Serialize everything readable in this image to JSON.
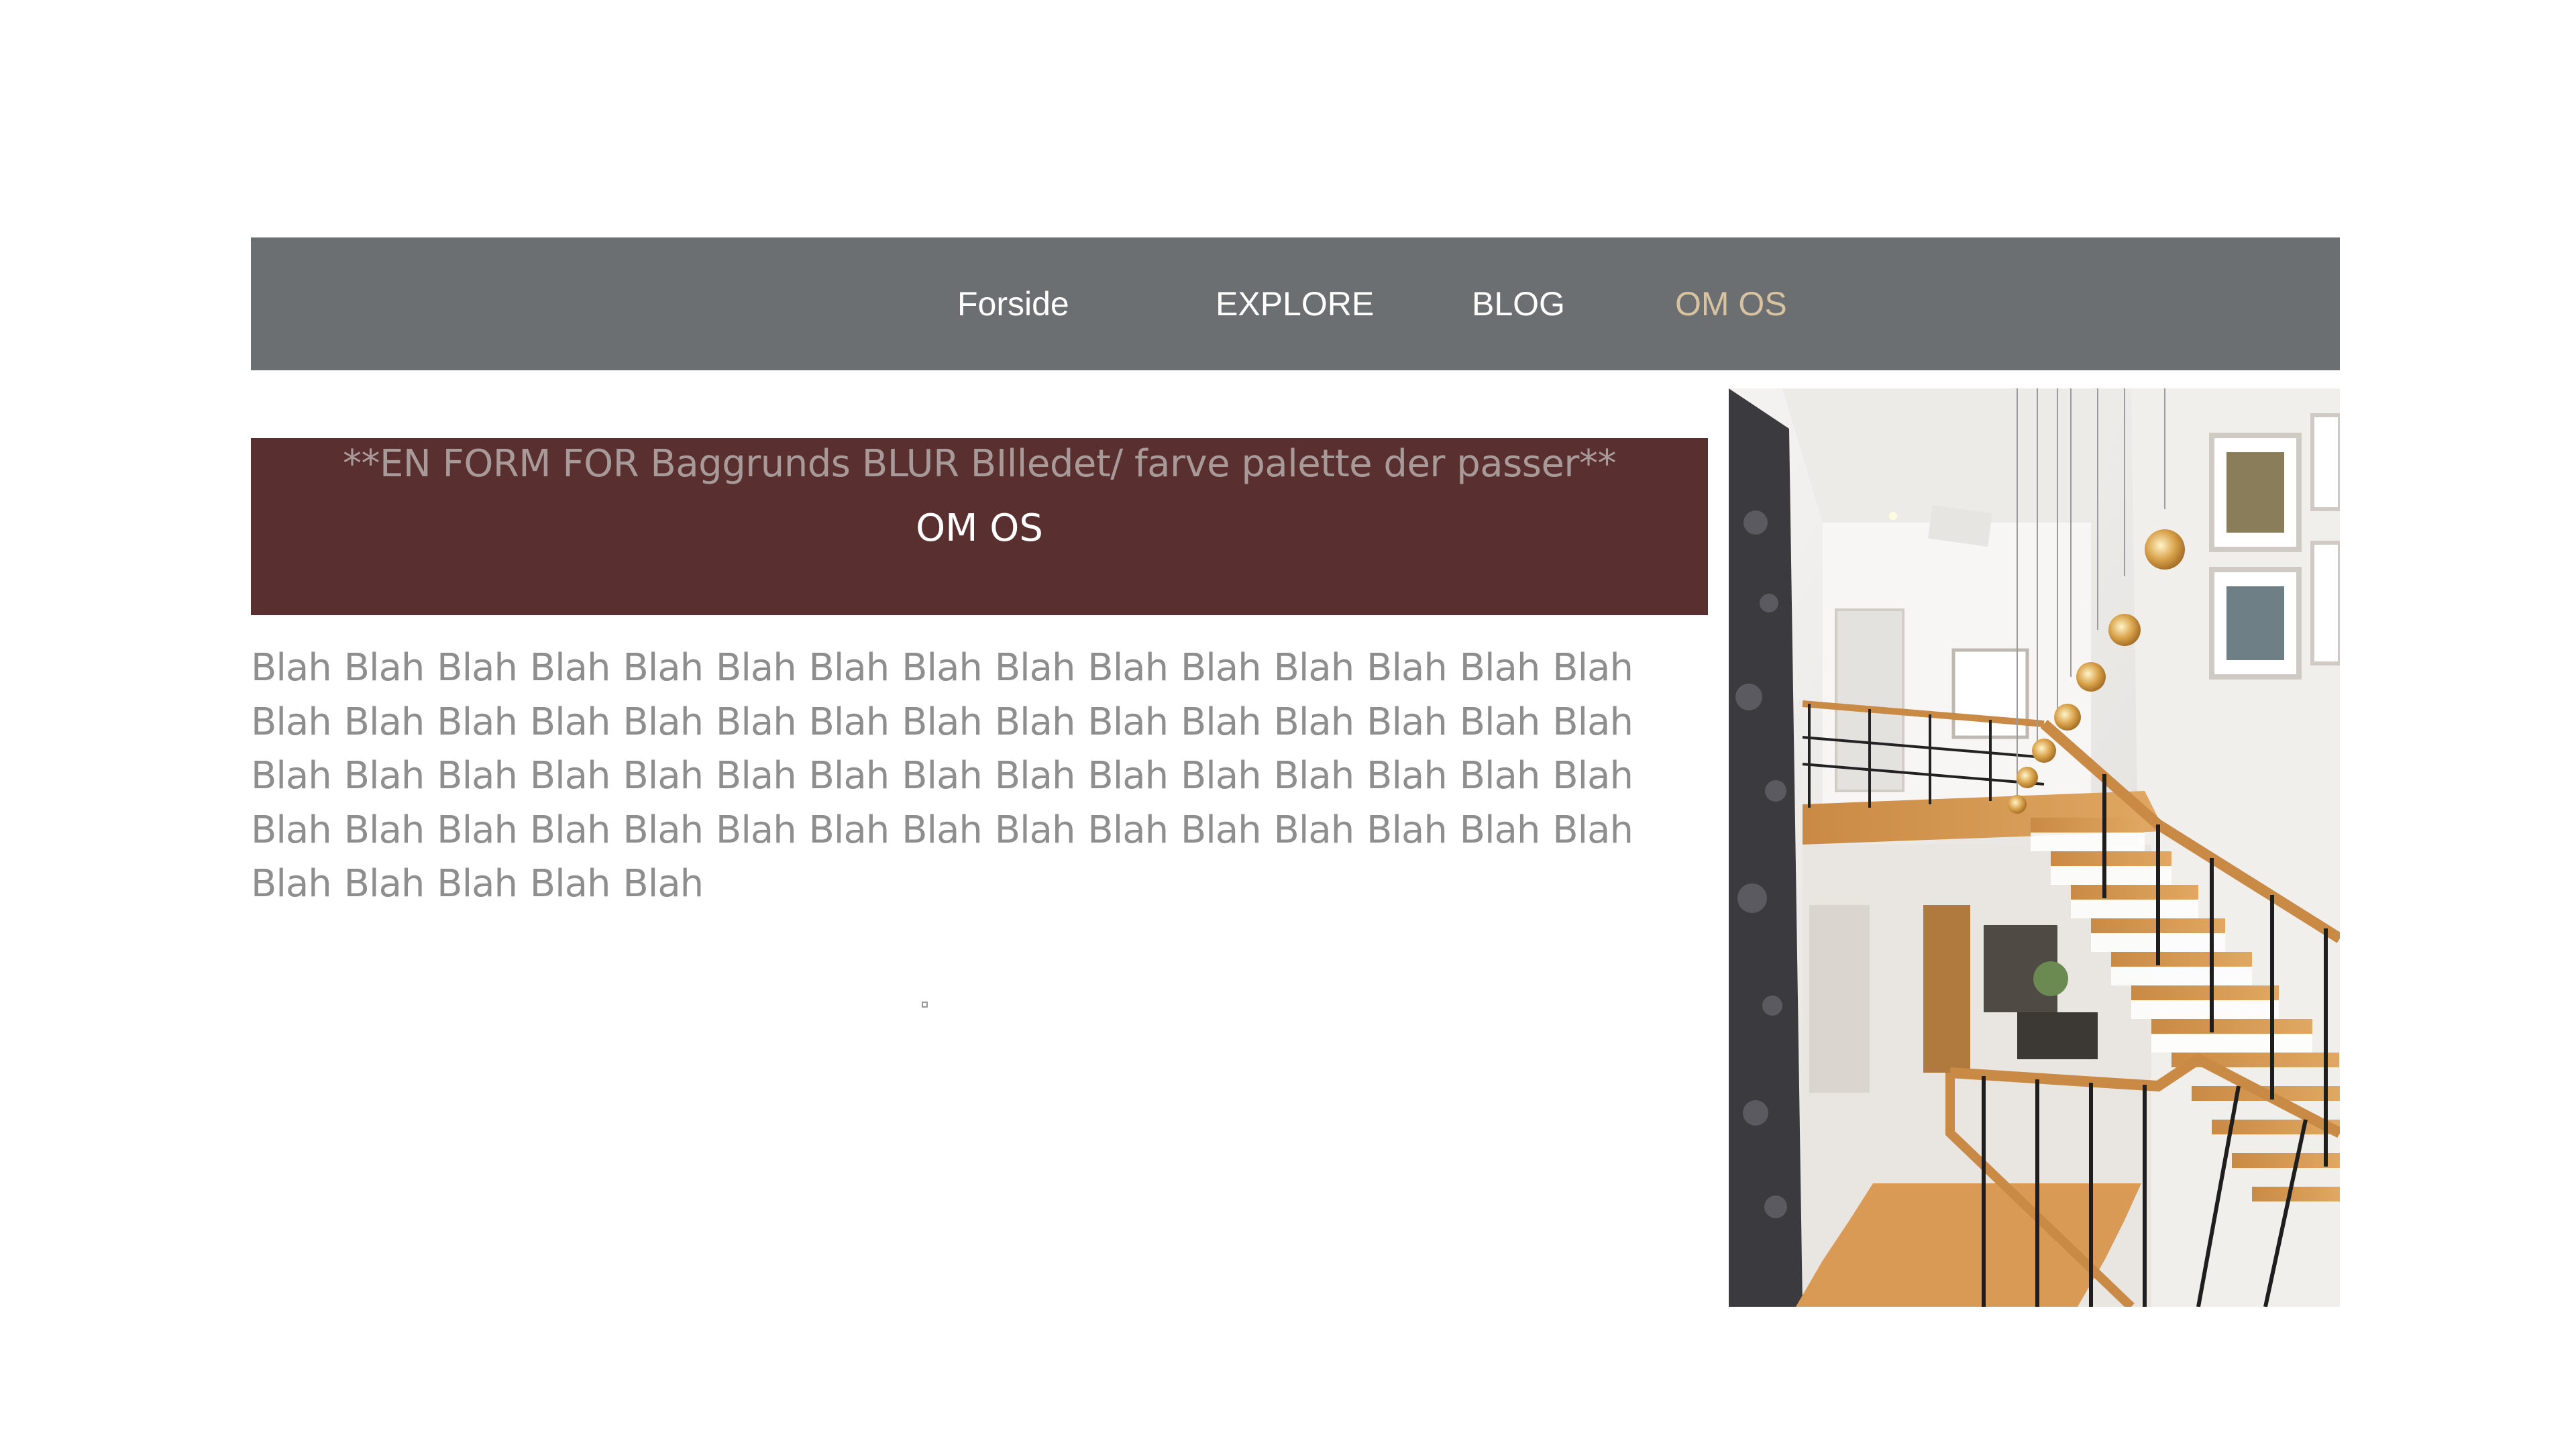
{
  "nav": {
    "items": [
      {
        "label": "Forside",
        "active": false
      },
      {
        "label": "EXPLORE",
        "active": false
      },
      {
        "label": "BLOG",
        "active": false
      },
      {
        "label": "OM OS",
        "active": true
      }
    ],
    "background": "#6b6f71",
    "active_color": "#d8c3a0"
  },
  "banner": {
    "note": "**EN FORM FOR  Baggrunds BLUR BIlledet/ farve palette der passer**",
    "title": "OM OS",
    "background": "#5a2f2f"
  },
  "body": {
    "text": "Blah Blah Blah Blah Blah Blah Blah Blah Blah Blah Blah Blah Blah Blah Blah Blah Blah Blah Blah Blah Blah Blah Blah Blah Blah Blah Blah Blah Blah Blah Blah Blah Blah Blah Blah Blah Blah Blah Blah Blah Blah Blah Blah Blah Blah Blah Blah Blah Blah Blah Blah Blah Blah Blah Blah Blah Blah Blah Blah Blah Blah Blah Blah Blah Blah"
  },
  "image": {
    "subject": "staircase-interior-photo"
  }
}
